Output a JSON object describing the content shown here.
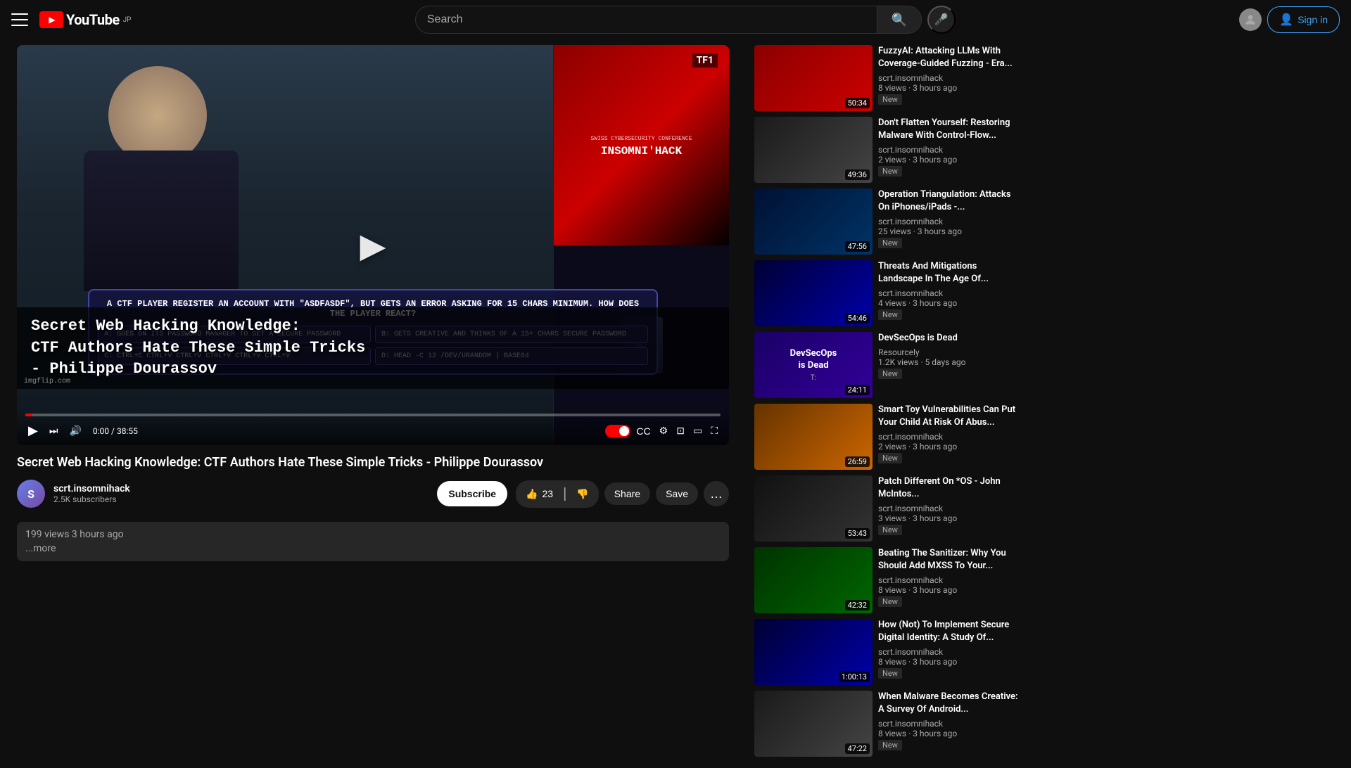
{
  "header": {
    "logo_text": "YouTube",
    "logo_country": "JP",
    "search_placeholder": "Search",
    "sign_in_label": "Sign in"
  },
  "video": {
    "title": "Secret Web Hacking Knowledge: CTF Authors Hate These Simple Tricks - Philippe Dourassov",
    "title_overlay_line1": "Secret Web Hacking Knowledge:",
    "title_overlay_line2": "CTF Authors Hate These Simple Tricks",
    "title_overlay_line3": "- Philippe Dourassov",
    "current_time": "0:00",
    "total_time": "38:55",
    "tf1_badge": "TF1",
    "watermark": "imgflip.com",
    "quiz_question": "A CTF PLAYER REGISTER AN ACCOUNT WITH \"ASDFASDF\", BUT GETS AN ERROR ASKING FOR 15 CHARS MINIMUM. HOW DOES THE PLAYER REACT?",
    "quiz_a": "A: GOES ON ITS PASSWORD MANAGER TO GET A SECURE PASSWORD",
    "quiz_b": "B: GETS CREATIVE AND THINKS OF A 15+ CHARS SECURE PASSWORD",
    "quiz_c": "C: CTRL+C CTRL+V CTRL+V CTRL+V CTRL+V CTRL+V",
    "quiz_d": "D: HEAD -C 12 /DEV/URANDOM | BASE64"
  },
  "channel": {
    "name": "scrt.insomnihack",
    "subscribers": "2.5K subscribers",
    "avatar_letter": "S"
  },
  "actions": {
    "like_count": "23",
    "share_label": "Share",
    "save_label": "Save",
    "subscribe_label": "Subscribe"
  },
  "video_meta": {
    "views": "199 views",
    "time_ago": "3 hours ago",
    "more_label": "...more"
  },
  "sidebar": {
    "videos": [
      {
        "title": "FuzzyAI: Attacking LLMs With Coverage-Guided Fuzzing - Era...",
        "channel": "scrt.insomnihack",
        "views": "8 views",
        "time_ago": "3 hours ago",
        "duration": "50:34",
        "new_badge": "New",
        "thumb_style": "thumb-red"
      },
      {
        "title": "Don't Flatten Yourself: Restoring Malware With Control-Flow...",
        "channel": "scrt.insomnihack",
        "views": "2 views",
        "time_ago": "3 hours ago",
        "duration": "49:36",
        "new_badge": "New",
        "thumb_style": "thumb-dark"
      },
      {
        "title": "Operation Triangulation: Attacks On iPhones/iPads -...",
        "channel": "scrt.insomnihack",
        "views": "25 views",
        "time_ago": "3 hours ago",
        "duration": "47:56",
        "new_badge": "New",
        "thumb_style": "thumb-cyber"
      },
      {
        "title": "Threats And Mitigations Landscape In The Age Of...",
        "channel": "scrt.insomnihack",
        "views": "4 views",
        "time_ago": "3 hours ago",
        "duration": "54:46",
        "new_badge": "New",
        "thumb_style": "thumb-blue"
      },
      {
        "title": "DevSecOps is Dead",
        "channel": "Resourcely",
        "views": "1.2K views",
        "time_ago": "5 days ago",
        "duration": "24:11",
        "new_badge": "New",
        "thumb_style": "thumb-devops",
        "special": "devsecops"
      },
      {
        "title": "Smart Toy Vulnerabilities Can Put Your Child At Risk Of Abus...",
        "channel": "scrt.insomnihack",
        "views": "2 views",
        "time_ago": "3 hours ago",
        "duration": "26:59",
        "new_badge": "New",
        "thumb_style": "thumb-orange"
      },
      {
        "title": "Patch Different On *OS - John McIntos...",
        "channel": "scrt.insomnihack",
        "views": "3 views",
        "time_ago": "3 hours ago",
        "duration": "53:43",
        "new_badge": "New",
        "thumb_style": "thumb-apple"
      },
      {
        "title": "Beating The Sanitizer: Why You Should Add MXSS To Your...",
        "channel": "scrt.insomnihack",
        "views": "8 views",
        "time_ago": "3 hours ago",
        "duration": "42:32",
        "new_badge": "New",
        "thumb_style": "thumb-green"
      },
      {
        "title": "How (Not) To Implement Secure Digital Identity: A Study Of...",
        "channel": "scrt.insomnihack",
        "views": "8 views",
        "time_ago": "3 hours ago",
        "duration": "1:00:13",
        "new_badge": "New",
        "thumb_style": "thumb-blue"
      },
      {
        "title": "When Malware Becomes Creative: A Survey Of Android...",
        "channel": "scrt.insomnihack",
        "views": "8 views",
        "time_ago": "3 hours ago",
        "duration": "47:22",
        "new_badge": "New",
        "thumb_style": "thumb-dark"
      }
    ]
  }
}
